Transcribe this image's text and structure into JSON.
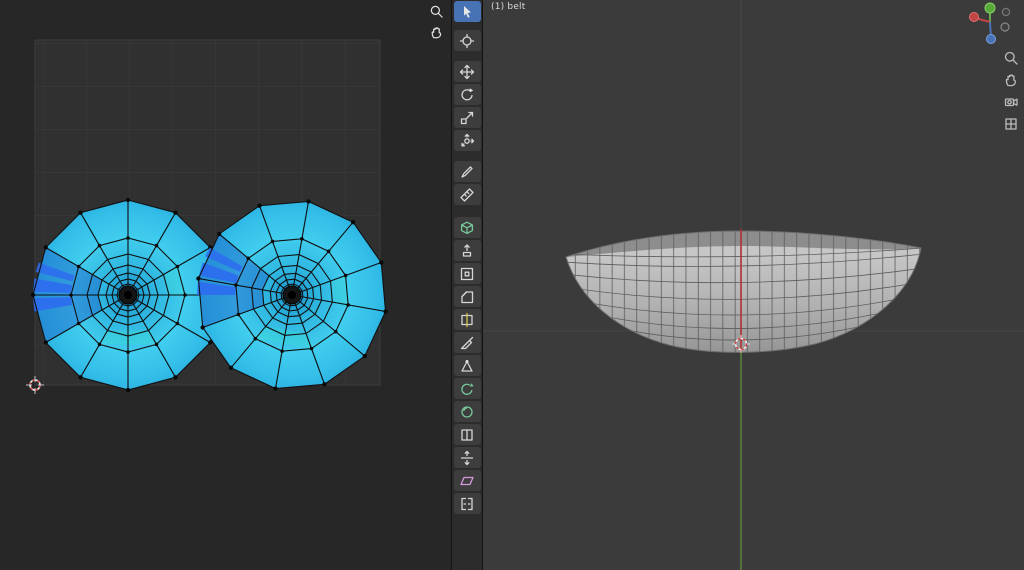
{
  "viewport": {
    "header_label": "(1) belt",
    "background": "#3b3b3b",
    "seam_color": "#b03030",
    "axis_green": "#5e8f3d",
    "mesh_color": "#b5b5b5",
    "side_icons": [
      "zoom",
      "pan",
      "camera-view",
      "toggle-orthographic"
    ],
    "gizmo_axes": [
      "x-red",
      "y-green",
      "z-blue"
    ]
  },
  "uv_editor": {
    "islands": 2,
    "island_fill": "#35c6ea",
    "selected_face_color": "#2e6cf0",
    "overlay_icons": [
      "zoom",
      "pan"
    ]
  },
  "toolbar": {
    "active_tool": "select-box",
    "active_color": "#4772b3",
    "tools": [
      "Select Box",
      "3D Cursor",
      "Move",
      "Rotate",
      "Scale",
      "Transform",
      "Annotate",
      "Measure",
      "Add Cube",
      "Extrude Region",
      "Inset Faces",
      "Bevel",
      "Loop Cut",
      "Knife",
      "Poly Build",
      "Spin",
      "Smooth",
      "Edge Slide",
      "Shrink/Fatten",
      "Shear",
      "Rip Region"
    ]
  }
}
